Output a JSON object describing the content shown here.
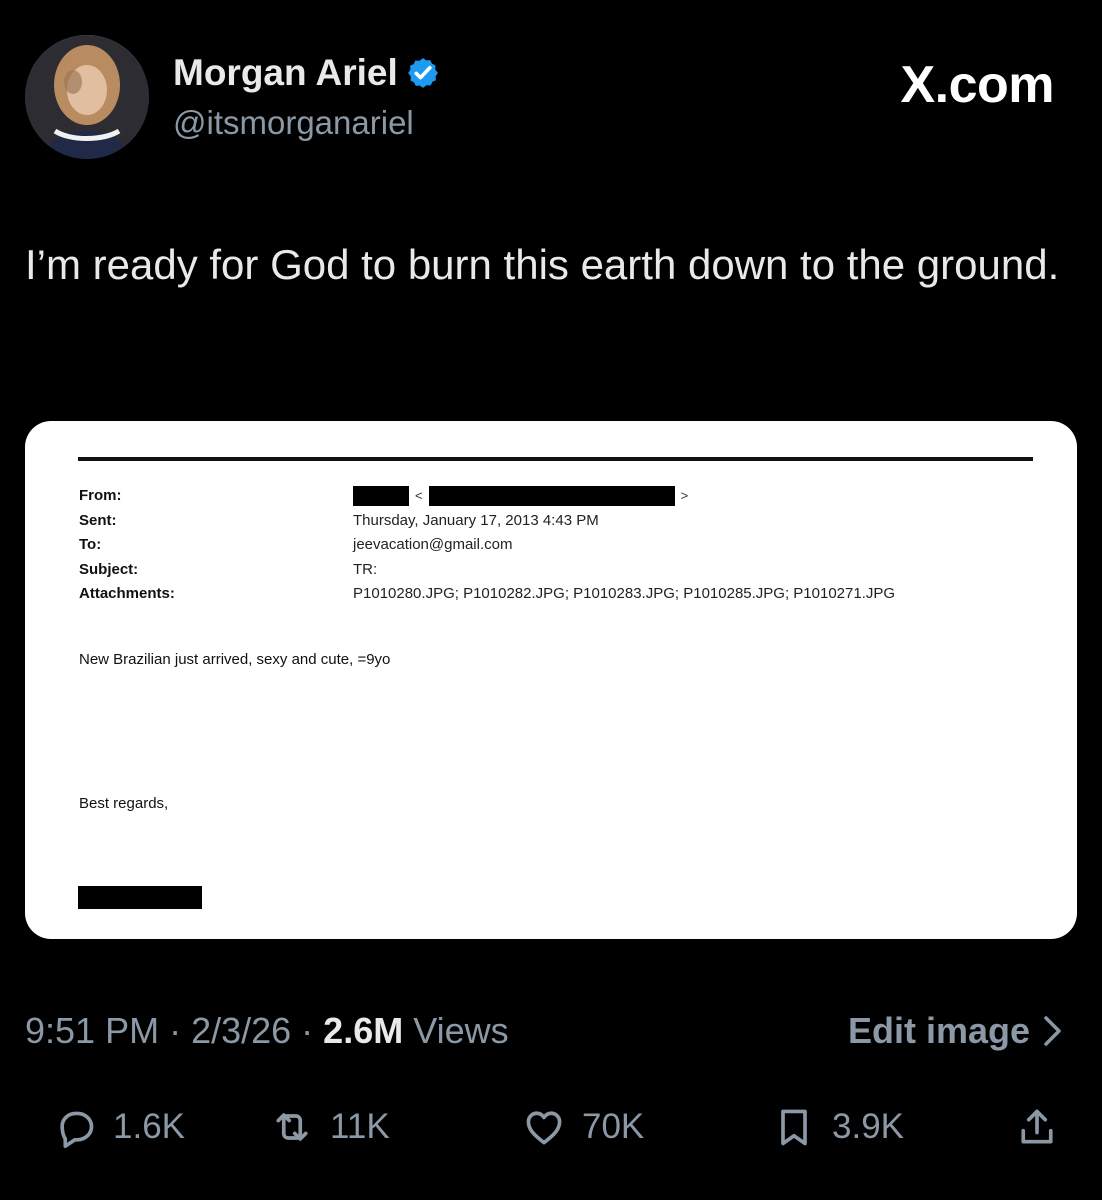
{
  "profile": {
    "name": "Morgan Ariel",
    "handle": "@itsmorganariel"
  },
  "brand": "X.com",
  "tweet": {
    "text": "I’m ready for God to burn this earth down to the ground."
  },
  "email": {
    "labels": [
      "From:",
      "Sent:",
      "To:",
      "Subject:",
      "Attachments:"
    ],
    "sent": "Thursday, January 17, 2013 4:43 PM",
    "to": "jeevacation@gmail.com",
    "subject": "TR:",
    "attachments": "P1010280.JPG; P1010282.JPG; P1010283.JPG; P1010285.JPG; P1010271.JPG",
    "body": "New Brazilian just arrived, sexy and cute, =9yo",
    "closing": "Best regards,"
  },
  "meta": {
    "time": "9:51 PM",
    "date": "2/3/26",
    "views_count": "2.6M",
    "views_label": "Views",
    "edit_label": "Edit image"
  },
  "actions": {
    "reply": "1.6K",
    "repost": "11K",
    "like": "70K",
    "bookmark": "3.9K"
  },
  "colors": {
    "background": "#000000",
    "text": "#e7e9ea",
    "muted": "#8b98a5",
    "verified": "#1d9bf0"
  }
}
